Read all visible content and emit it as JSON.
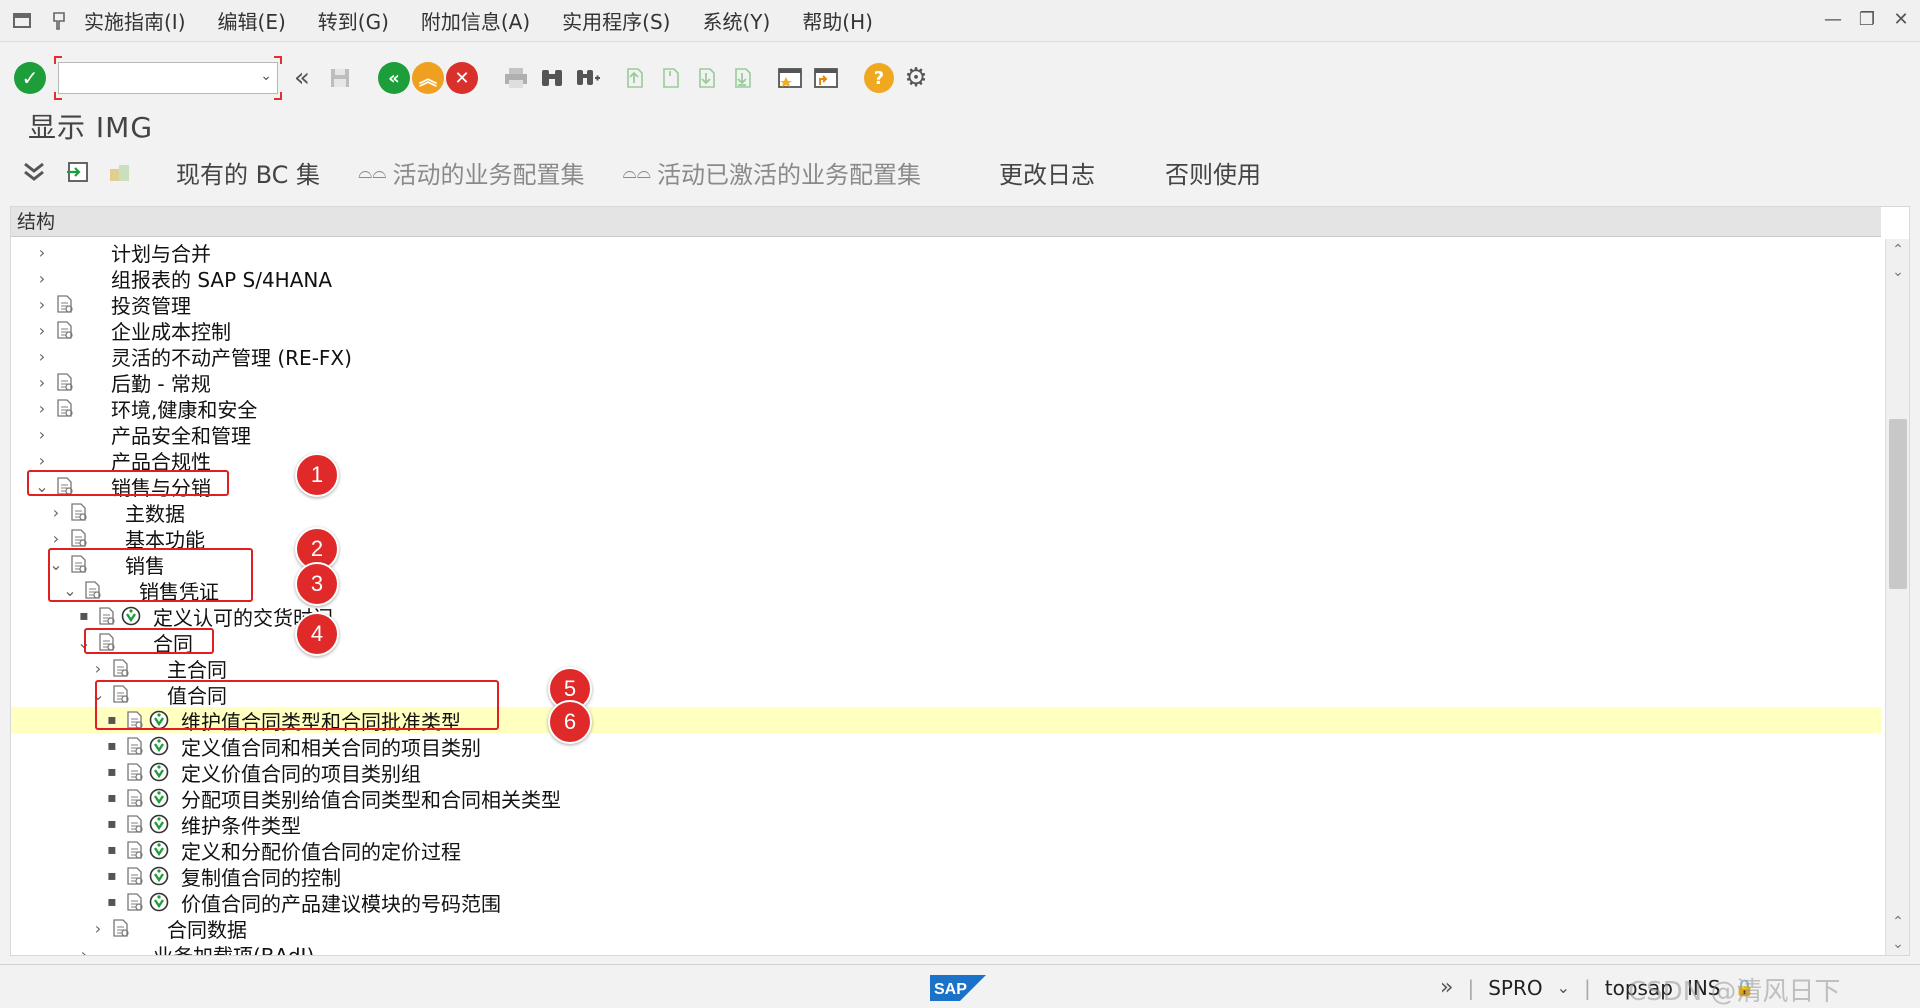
{
  "menu": {
    "items": [
      "实施指南(I)",
      "编辑(E)",
      "转到(G)",
      "附加信息(A)",
      "实用程序(S)",
      "系统(Y)",
      "帮助(H)"
    ]
  },
  "toolbar": {
    "command_value": ""
  },
  "title": "显示 IMG",
  "app_toolbar": {
    "buttons": [
      "现有的 BC 集",
      "活动的业务配置集",
      "活动已激活的业务配置集",
      "更改日志",
      "否则使用"
    ]
  },
  "tree": {
    "column_header": "结构",
    "rows": [
      {
        "label": "计划与合并",
        "level": 0,
        "expander": "right",
        "doc": false,
        "exec": false
      },
      {
        "label": "组报表的 SAP S/4HANA",
        "level": 0,
        "expander": "right",
        "doc": false,
        "exec": false
      },
      {
        "label": "投资管理",
        "level": 0,
        "expander": "right",
        "doc": true,
        "exec": false
      },
      {
        "label": "企业成本控制",
        "level": 0,
        "expander": "right",
        "doc": true,
        "exec": false
      },
      {
        "label": "灵活的不动产管理 (RE-FX)",
        "level": 0,
        "expander": "right",
        "doc": false,
        "exec": false
      },
      {
        "label": "后勤 - 常规",
        "level": 0,
        "expander": "right",
        "doc": true,
        "exec": false
      },
      {
        "label": "环境,健康和安全",
        "level": 0,
        "expander": "right",
        "doc": true,
        "exec": false
      },
      {
        "label": "产品安全和管理",
        "level": 0,
        "expander": "right",
        "doc": false,
        "exec": false
      },
      {
        "label": "产品合规性",
        "level": 0,
        "expander": "right",
        "doc": false,
        "exec": false
      },
      {
        "label": "销售与分销",
        "level": 0,
        "expander": "down",
        "doc": true,
        "exec": false
      },
      {
        "label": "主数据",
        "level": 1,
        "expander": "right",
        "doc": true,
        "exec": false
      },
      {
        "label": "基本功能",
        "level": 1,
        "expander": "right",
        "doc": true,
        "exec": false
      },
      {
        "label": "销售",
        "level": 1,
        "expander": "down",
        "doc": true,
        "exec": false
      },
      {
        "label": "销售凭证",
        "level": 2,
        "expander": "down",
        "doc": true,
        "exec": false
      },
      {
        "label": "定义认可的交货时间",
        "level": 3,
        "expander": "bullet",
        "doc": true,
        "exec": true
      },
      {
        "label": "合同",
        "level": 3,
        "expander": "down",
        "doc": true,
        "exec": false
      },
      {
        "label": "主合同",
        "level": 4,
        "expander": "right",
        "doc": true,
        "exec": false
      },
      {
        "label": "值合同",
        "level": 4,
        "expander": "down",
        "doc": true,
        "exec": false
      },
      {
        "label": "维护值合同类型和合同批准类型",
        "level": 5,
        "expander": "bullet",
        "doc": true,
        "exec": true,
        "highlight": true
      },
      {
        "label": "定义值合同和相关合同的项目类别",
        "level": 5,
        "expander": "bullet",
        "doc": true,
        "exec": true
      },
      {
        "label": "定义价值合同的项目类别组",
        "level": 5,
        "expander": "bullet",
        "doc": true,
        "exec": true
      },
      {
        "label": "分配项目类别给值合同类型和合同相关类型",
        "level": 5,
        "expander": "bullet",
        "doc": true,
        "exec": true
      },
      {
        "label": "维护条件类型",
        "level": 5,
        "expander": "bullet",
        "doc": true,
        "exec": true
      },
      {
        "label": "定义和分配价值合同的定价过程",
        "level": 5,
        "expander": "bullet",
        "doc": true,
        "exec": true
      },
      {
        "label": "复制值合同的控制",
        "level": 5,
        "expander": "bullet",
        "doc": true,
        "exec": true
      },
      {
        "label": "价值合同的产品建议模块的号码范围",
        "level": 5,
        "expander": "bullet",
        "doc": true,
        "exec": true
      },
      {
        "label": "合同数据",
        "level": 4,
        "expander": "right",
        "doc": true,
        "exec": false
      },
      {
        "label": "业务加载项(BAdI)",
        "level": 3,
        "expander": "right",
        "doc": false,
        "exec": false
      }
    ]
  },
  "annotations": [
    "1",
    "2",
    "3",
    "4",
    "5",
    "6"
  ],
  "status": {
    "transaction": "SPRO",
    "system": "topsap",
    "mode": "INS",
    "watermark": "CSDN @清风日下"
  },
  "colors": {
    "highlight_row": "#ffffc0",
    "annotation_red": "#e02020",
    "ok_green": "#1e9e3a",
    "cancel_red": "#d9302c",
    "exit_orange": "#f0a020"
  }
}
